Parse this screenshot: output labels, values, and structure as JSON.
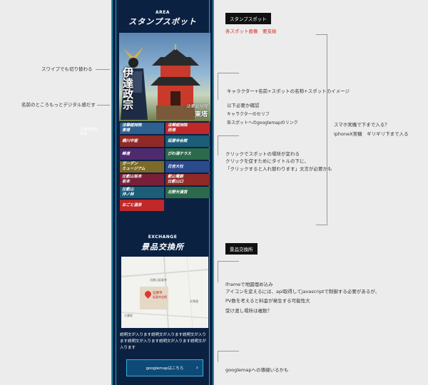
{
  "left_notes": {
    "swipe": "スワイプでも切り替わる",
    "name_more": "名前のところもっとデジタル感だす"
  },
  "phone": {
    "area": {
      "sub": "AREA",
      "title": "スタンプスポット"
    },
    "hero": {
      "character": "伊達政宗",
      "spot_sub": "法華総持院",
      "spot_title": "東塔"
    },
    "spots": [
      {
        "a": "法華総持院",
        "b": "東塔",
        "color": "#2f5f8c"
      },
      {
        "a": "法華総持院",
        "b": "西塔",
        "color": "#c0282a"
      },
      {
        "a": "横川中堂",
        "b": "",
        "color": "#8f2a28"
      },
      {
        "a": "延暦寺会館",
        "b": "",
        "color": "#1c5d78"
      },
      {
        "a": "峰道",
        "b": "",
        "color": "#4e2a6f"
      },
      {
        "a": "びわ湖テラス",
        "b": "",
        "color": "#2b6b4c"
      },
      {
        "a": "ガーデン",
        "b": "ミュージアム",
        "color": "#7b6a28"
      },
      {
        "a": "日吉大社",
        "b": "",
        "color": "#2a4a8c"
      },
      {
        "a": "比叡山坂本",
        "b": "坂本",
        "color": "#7a1f3a"
      },
      {
        "a": "叡山電鉄",
        "b": "比叡山口",
        "color": "#8f2a28"
      },
      {
        "a": "比叡山",
        "b": "沖ノ林",
        "color": "#1c5d78"
      },
      {
        "a": "北野天満宮",
        "b": "",
        "color": "#2b6b4c"
      },
      {
        "a": "おごと温泉",
        "b": "",
        "color": "#c0282a"
      }
    ],
    "exchange": {
      "sub": "EXCHANGE",
      "title": "景品交換所"
    },
    "map": {
      "place": "延暦寺",
      "place_sub": "延暦寺会館",
      "label1": "比叡山延暦寺",
      "label2": "大講堂",
      "label3": "文殊楼"
    },
    "desc": "説明文が入ります説明文が入ります説明文が入ります説明文が入ります説明文が入ります説明文が入ります",
    "button": "googlemapはこちら",
    "overlay_small": "法華総持院\n東塔"
  },
  "right_notes": {
    "stamp_label": "スタンプスポット",
    "image_req": "各スポット画像　要支給",
    "hero_note": "キャラクター+名前+スポットの名称+スポットのイメージ",
    "confirm": "以下必要か確認",
    "serif": "キャラクターのセリフ",
    "gmap_link": "各スポットへのgooglemapのリンク",
    "scroll1": "スマホ実機で下まで入る？",
    "scroll2": "iphoneX実機　ギリギリ下まで入る",
    "click1": "クリックでスポットの場所が変わる",
    "click2": "クリックを促すためにタイトルの下に、",
    "click3": "「クリックすると入れ替わります」文言が必要かも",
    "exchange_label": "景品交換所",
    "iframe1": "iframeで地図埋め込み",
    "iframe2": "アイコンを変えるには、api取得してjavascriptで制御する必要があるが、",
    "iframe3": "PV数を考えると料金が発生する可能性大",
    "iframe4": "受け渡し場所は複数？",
    "gmap_nav": "googlemapへの導線いるかも"
  }
}
